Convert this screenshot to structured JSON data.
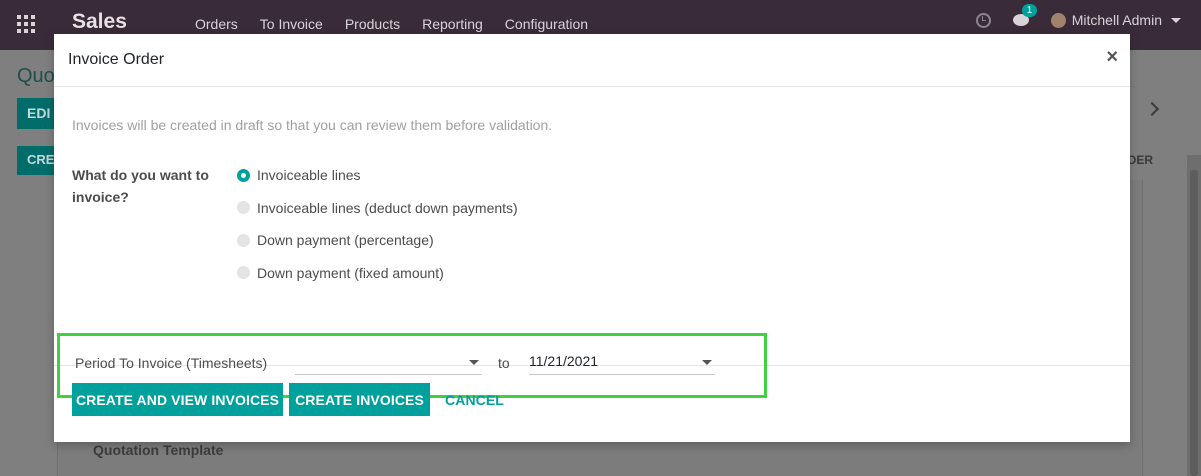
{
  "navbar": {
    "brand": "Sales",
    "menu": [
      "Orders",
      "To Invoice",
      "Products",
      "Reporting",
      "Configuration"
    ],
    "chat_badge": "1",
    "user_name": "Mitchell Admin"
  },
  "background": {
    "breadcrumb": "Quo",
    "edit_label": "EDI",
    "create_label": "CRE",
    "status_text": "DER",
    "field_label": "Quotation Template"
  },
  "modal": {
    "title": "Invoice Order",
    "close_glyph": "×",
    "info_text": "Invoices will be created in draft so that you can review them before validation.",
    "question_label": "What do you want to invoice?",
    "options": [
      {
        "label": "Invoiceable lines",
        "checked": true
      },
      {
        "label": "Invoiceable lines (deduct down payments)",
        "checked": false
      },
      {
        "label": "Down payment (percentage)",
        "checked": false
      },
      {
        "label": "Down payment (fixed amount)",
        "checked": false
      }
    ],
    "period_label": "Period To Invoice (Timesheets)",
    "date_from": "",
    "to_label": "to",
    "date_to": "11/21/2021",
    "buttons": {
      "create_view": "Create and View Invoices",
      "create": "Create Invoices",
      "cancel": "Cancel"
    }
  },
  "colors": {
    "navbar": "#3a2b38",
    "accent": "#00a09d",
    "highlight_box": "#3fd13f"
  },
  "icons": {
    "apps": "apps-grid-icon",
    "clock": "clock-icon",
    "chat": "chat-icon",
    "avatar": "user-avatar",
    "pager_next": "chevron-right-icon"
  }
}
